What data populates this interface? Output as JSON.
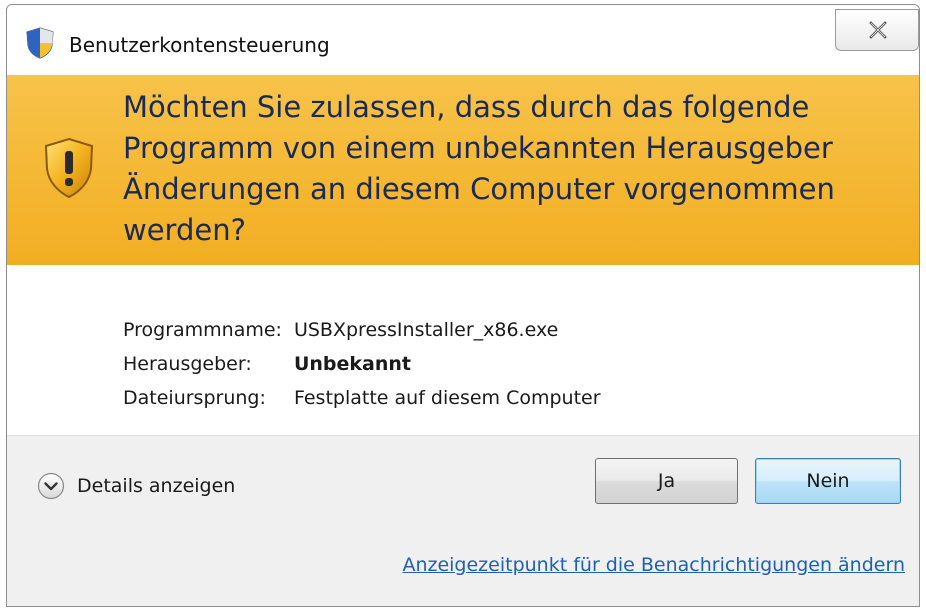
{
  "window": {
    "title": "Benutzerkontensteuerung",
    "title_icon": "uac-shield-icon",
    "close_icon": "close-x-icon"
  },
  "banner": {
    "icon": "warning-shield-icon",
    "question": "Möchten Sie zulassen, dass durch das folgende Programm von einem unbekannten Herausgeber Änderungen an diesem Computer vorgenommen werden?",
    "background_color": "#f4b535"
  },
  "program_info": {
    "rows": [
      {
        "label": "Programmname:",
        "value": "USBXpressInstaller_x86.exe",
        "bold": false
      },
      {
        "label": "Herausgeber:",
        "value": "Unbekannt",
        "bold": true
      },
      {
        "label": "Dateiursprung:",
        "value": "Festplatte auf diesem Computer",
        "bold": false
      }
    ]
  },
  "footer": {
    "details_toggle_label": "Details anzeigen",
    "details_toggle_icon": "chevron-down-circle-icon",
    "yes_button": "Ja",
    "no_button": "Nein",
    "notification_link": "Anzeigezeitpunkt für die Benachrichtigungen ändern"
  }
}
